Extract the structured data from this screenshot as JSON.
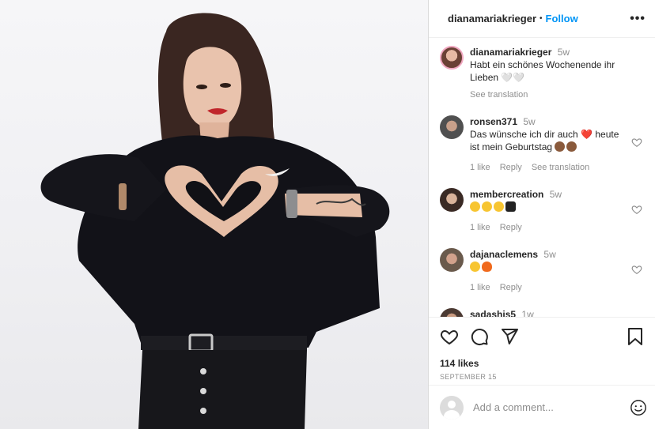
{
  "header": {
    "username": "dianamariakrieger",
    "separator": "•",
    "follow_label": "Follow",
    "more_label": "•••"
  },
  "comments": [
    {
      "user": "dianamariakrieger",
      "time": "5w",
      "text_line1": "Habt ein schönes Wochenende ihr",
      "text_line2": "Lieben 🤍🤍",
      "see_translation": "See translation"
    },
    {
      "user": "ronsen371",
      "time": "5w",
      "text_line1": "Das wünsche ich dir auch",
      "text_heart": "❤️",
      "text_line1b": "heute",
      "text_line2": "ist mein Geburtstag",
      "likes": "1 like",
      "reply": "Reply",
      "see_translation": "See translation"
    },
    {
      "user": "membercreation",
      "time": "5w",
      "emoji": [
        "heart-eyes",
        "heart-eyes",
        "heart-eyes",
        "black-heart"
      ],
      "likes": "1 like",
      "reply": "Reply"
    },
    {
      "user": "dajanaclemens",
      "time": "5w",
      "emoji": [
        "heart-eyes",
        "fire"
      ],
      "likes": "1 like",
      "reply": "Reply"
    },
    {
      "user": "sadashis5",
      "time": "1w"
    }
  ],
  "actions": {
    "likes": "114 likes",
    "date": "SEPTEMBER 15"
  },
  "add_comment": {
    "placeholder": "Add a comment..."
  },
  "colors": {
    "link": "#0095f6",
    "heart_red": "#ed4956",
    "muted": "#8e8e8e"
  }
}
